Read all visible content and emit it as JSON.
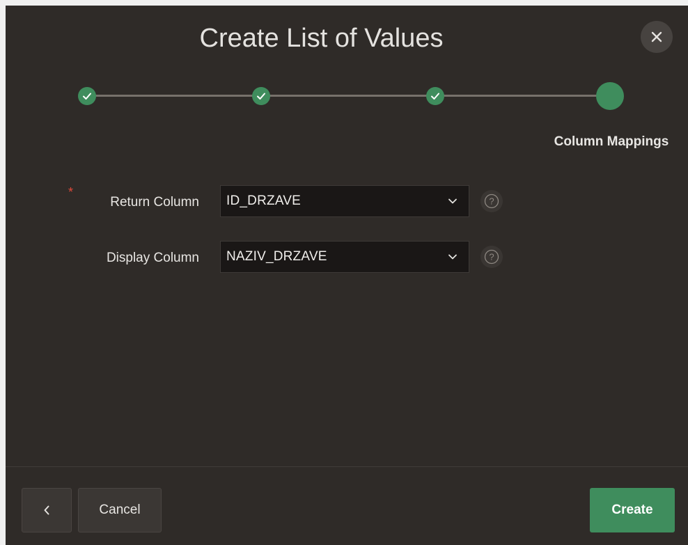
{
  "dialog": {
    "title": "Create List of Values",
    "close_icon": "close-icon"
  },
  "wizard": {
    "steps": [
      {
        "state": "complete",
        "icon": "check-icon"
      },
      {
        "state": "complete",
        "icon": "check-icon"
      },
      {
        "state": "complete",
        "icon": "check-icon"
      },
      {
        "state": "current"
      }
    ],
    "current_step_label": "Column Mappings"
  },
  "form": {
    "return_column": {
      "label": "Return Column",
      "required": true,
      "required_mark": "*",
      "value": "ID_DRZAVE"
    },
    "display_column": {
      "label": "Display Column",
      "required": false,
      "value": "NAZIV_DRZAVE"
    },
    "help_icon": "help-icon",
    "help_glyph": "?"
  },
  "footer": {
    "previous_icon": "chevron-left-icon",
    "cancel_label": "Cancel",
    "create_label": "Create"
  },
  "colors": {
    "background": "#2f2b28",
    "accent": "#3f8d5d",
    "required": "#e0493a",
    "input_bg": "#1a1716"
  }
}
